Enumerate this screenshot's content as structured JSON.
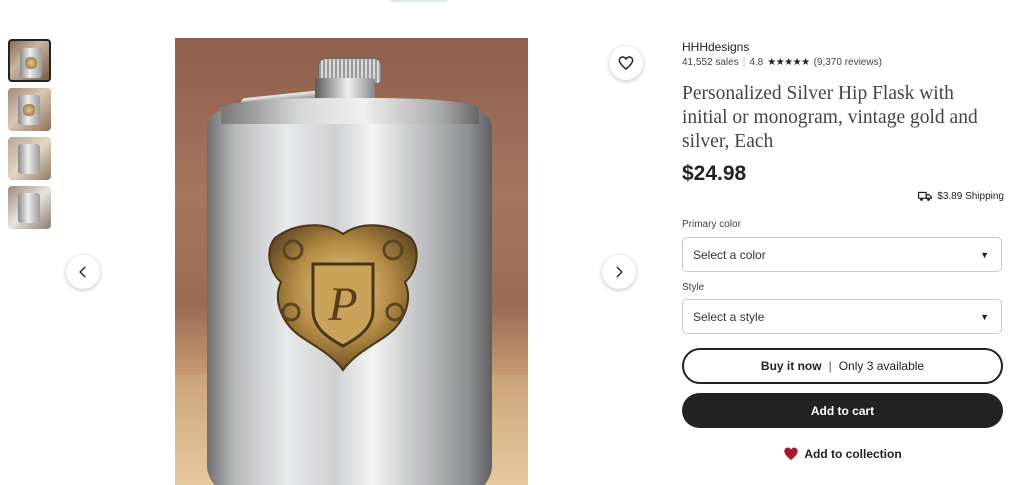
{
  "gallery": {
    "thumbnails": [
      {
        "label": "Thumbnail 1"
      },
      {
        "label": "Thumbnail 2"
      },
      {
        "label": "Thumbnail 3"
      },
      {
        "label": "Thumbnail 4"
      }
    ],
    "active_index": 0,
    "engraving_letter": "P"
  },
  "seller": {
    "shop_name": "HHHdesigns",
    "sales": "41,552 sales",
    "rating": "4.8",
    "stars": "★★★★★",
    "reviews": "(9,370 reviews)"
  },
  "product": {
    "title": "Personalized Silver Hip Flask with initial or monogram, vintage gold and silver, Each",
    "price": "$24.98",
    "shipping": "$3.89 Shipping"
  },
  "options": {
    "primary_color_label": "Primary color",
    "primary_color_value": "Select a color",
    "style_label": "Style",
    "style_value": "Select a style"
  },
  "actions": {
    "buy_now": "Buy it now",
    "separator": "|",
    "availability": "Only 3 available",
    "add_to_cart": "Add to cart",
    "add_to_collection": "Add to collection"
  },
  "colors": {
    "accent_dark": "#222222",
    "heart_red": "#a61a2e",
    "border": "#c9c9c9"
  },
  "icons": [
    "heart-icon",
    "chevron-left-icon",
    "chevron-right-icon",
    "truck-icon",
    "caret-down-icon",
    "heart-filled-icon"
  ]
}
